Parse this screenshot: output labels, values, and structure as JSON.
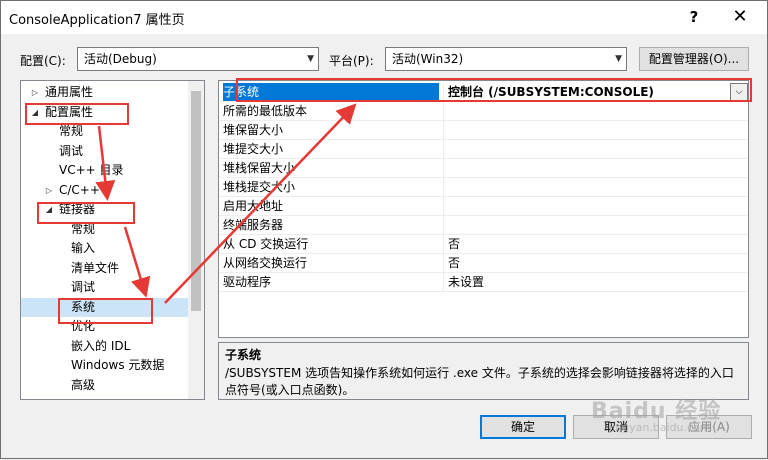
{
  "window": {
    "title": "ConsoleApplication7 属性页",
    "help": "?",
    "close": "✕"
  },
  "top": {
    "config_label": "配置(C):",
    "config_value": "活动(Debug)",
    "platform_label": "平台(P):",
    "platform_value": "活动(Win32)",
    "config_manager": "配置管理器(O)..."
  },
  "tree": {
    "items": [
      {
        "label": "通用属性",
        "twisty": "▷"
      },
      {
        "label": "配置属性",
        "twisty": "◢"
      },
      {
        "label": "常规",
        "twisty": ""
      },
      {
        "label": "调试",
        "twisty": ""
      },
      {
        "label": "VC++ 目录",
        "twisty": ""
      },
      {
        "label": "C/C++",
        "twisty": "▷"
      },
      {
        "label": "链接器",
        "twisty": "◢"
      },
      {
        "label": "常规",
        "twisty": ""
      },
      {
        "label": "输入",
        "twisty": ""
      },
      {
        "label": "清单文件",
        "twisty": ""
      },
      {
        "label": "调试",
        "twisty": ""
      },
      {
        "label": "系统",
        "twisty": ""
      },
      {
        "label": "优化",
        "twisty": ""
      },
      {
        "label": "嵌入的 IDL",
        "twisty": ""
      },
      {
        "label": "Windows 元数据",
        "twisty": ""
      },
      {
        "label": "高级",
        "twisty": ""
      }
    ]
  },
  "grid": {
    "rows": [
      {
        "key": "子系统",
        "value": "控制台 (/SUBSYSTEM:CONSOLE)"
      },
      {
        "key": "所需的最低版本",
        "value": ""
      },
      {
        "key": "堆保留大小",
        "value": ""
      },
      {
        "key": "堆提交大小",
        "value": ""
      },
      {
        "key": "堆栈保留大小",
        "value": ""
      },
      {
        "key": "堆栈提交大小",
        "value": ""
      },
      {
        "key": "启用大地址",
        "value": ""
      },
      {
        "key": "终端服务器",
        "value": ""
      },
      {
        "key": "从 CD 交换运行",
        "value": "否"
      },
      {
        "key": "从网络交换运行",
        "value": "否"
      },
      {
        "key": "驱动程序",
        "value": "未设置"
      }
    ],
    "dropdown_glyph": "⌵"
  },
  "description": {
    "title": "子系统",
    "text": "/SUBSYSTEM 选项告知操作系统如何运行 .exe 文件。子系统的选择会影响链接器将选择的入口点符号(或入口点函数)。"
  },
  "buttons": {
    "ok": "确定",
    "cancel": "取消",
    "apply": "应用(A)"
  },
  "watermark": {
    "brand": "Baidu 经验",
    "url": "jingyan.baidu.com"
  },
  "annotation_color": "#e53935",
  "selection_color": "#0078d7"
}
